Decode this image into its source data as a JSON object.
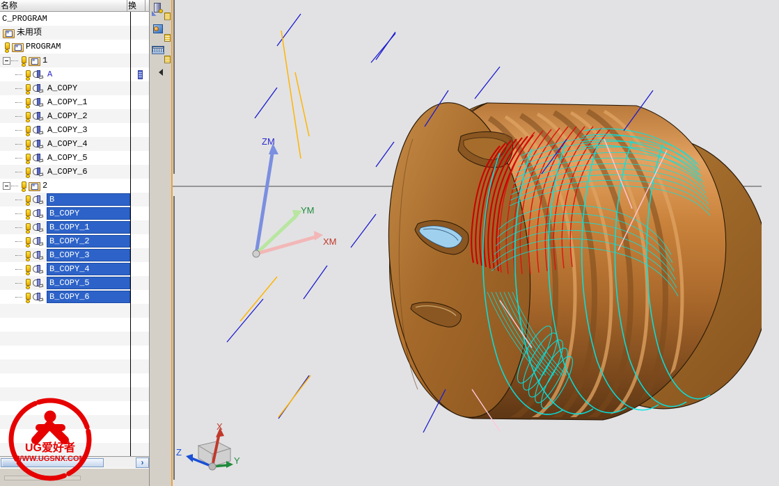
{
  "window": {
    "app": "UG NX Operation Navigator",
    "background_color": "#d4d0c8"
  },
  "navigator": {
    "columns": [
      {
        "key": "name",
        "label": "名称"
      },
      {
        "key": "transform",
        "label": "换"
      }
    ],
    "rows": [
      {
        "indent": 0,
        "text": "C_PROGRAM",
        "type": "root",
        "icon": "none",
        "expander": "none",
        "selected": false,
        "warn": false,
        "extra": ""
      },
      {
        "indent": 1,
        "text": "未用项",
        "type": "group",
        "icon": "folder-icon",
        "expander": "none",
        "selected": false,
        "warn": false,
        "extra": ""
      },
      {
        "indent": 1,
        "text": "PROGRAM",
        "type": "group",
        "icon": "folder-icon",
        "expander": "none",
        "selected": false,
        "warn": true,
        "extra": ""
      },
      {
        "indent": 1,
        "text": "1",
        "type": "group",
        "icon": "folder-icon",
        "expander": "minus",
        "selected": false,
        "warn": true,
        "extra": ""
      },
      {
        "indent": 2,
        "text": "A",
        "type": "op",
        "icon": "operation-icon",
        "expander": "none",
        "selected": false,
        "warn": true,
        "extra": "transform-icon",
        "blue": true
      },
      {
        "indent": 2,
        "text": "A_COPY",
        "type": "op",
        "icon": "operation-icon",
        "expander": "none",
        "selected": false,
        "warn": true,
        "extra": ""
      },
      {
        "indent": 2,
        "text": "A_COPY_1",
        "type": "op",
        "icon": "operation-icon",
        "expander": "none",
        "selected": false,
        "warn": true,
        "extra": ""
      },
      {
        "indent": 2,
        "text": "A_COPY_2",
        "type": "op",
        "icon": "operation-icon",
        "expander": "none",
        "selected": false,
        "warn": true,
        "extra": ""
      },
      {
        "indent": 2,
        "text": "A_COPY_3",
        "type": "op",
        "icon": "operation-icon",
        "expander": "none",
        "selected": false,
        "warn": true,
        "extra": ""
      },
      {
        "indent": 2,
        "text": "A_COPY_4",
        "type": "op",
        "icon": "operation-icon",
        "expander": "none",
        "selected": false,
        "warn": true,
        "extra": ""
      },
      {
        "indent": 2,
        "text": "A_COPY_5",
        "type": "op",
        "icon": "operation-icon",
        "expander": "none",
        "selected": false,
        "warn": true,
        "extra": ""
      },
      {
        "indent": 2,
        "text": "A_COPY_6",
        "type": "op",
        "icon": "operation-icon",
        "expander": "none",
        "selected": false,
        "warn": true,
        "extra": ""
      },
      {
        "indent": 1,
        "text": "2",
        "type": "group",
        "icon": "folder-icon",
        "expander": "minus",
        "selected": false,
        "warn": true,
        "extra": ""
      },
      {
        "indent": 2,
        "text": "B",
        "type": "op",
        "icon": "operation-icon",
        "expander": "none",
        "selected": true,
        "warn": true,
        "extra": ""
      },
      {
        "indent": 2,
        "text": "B_COPY",
        "type": "op",
        "icon": "operation-icon",
        "expander": "none",
        "selected": true,
        "warn": true,
        "extra": ""
      },
      {
        "indent": 2,
        "text": "B_COPY_1",
        "type": "op",
        "icon": "operation-icon",
        "expander": "none",
        "selected": true,
        "warn": true,
        "extra": ""
      },
      {
        "indent": 2,
        "text": "B_COPY_2",
        "type": "op",
        "icon": "operation-icon",
        "expander": "none",
        "selected": true,
        "warn": true,
        "extra": ""
      },
      {
        "indent": 2,
        "text": "B_COPY_3",
        "type": "op",
        "icon": "operation-icon",
        "expander": "none",
        "selected": true,
        "warn": true,
        "extra": ""
      },
      {
        "indent": 2,
        "text": "B_COPY_4",
        "type": "op",
        "icon": "operation-icon",
        "expander": "none",
        "selected": true,
        "warn": true,
        "extra": ""
      },
      {
        "indent": 2,
        "text": "B_COPY_5",
        "type": "op",
        "icon": "operation-icon",
        "expander": "none",
        "selected": true,
        "warn": true,
        "extra": ""
      },
      {
        "indent": 2,
        "text": "B_COPY_6",
        "type": "op",
        "icon": "operation-icon",
        "expander": "none",
        "selected": true,
        "warn": true,
        "extra": ""
      }
    ],
    "empty_row_count": 13,
    "selection_color": "#2d63c8",
    "scrollbar": {
      "right_arrow": "›"
    }
  },
  "toolbar": {
    "buttons": [
      {
        "name": "create-tool-button",
        "tooltip": "创建刀具"
      },
      {
        "name": "create-geometry-button",
        "tooltip": "创建几何体"
      },
      {
        "name": "create-method-button",
        "tooltip": "创建方法"
      }
    ],
    "collapse_label": "◀"
  },
  "graphics": {
    "background_color": "#e2e2e4",
    "model_color": "#b5762f",
    "toolpath_cut_color": "#00e5e5",
    "toolpath_rapid_color": "#1a1ad0",
    "toolpath_engage_color": "#ffc000",
    "toolpath_retract_color": "#ffc8dc",
    "highlight_color": "#cc0000",
    "wcs_labels": {
      "x": "XM",
      "y": "YM",
      "z": "ZM"
    },
    "triad_labels": {
      "x": "X",
      "y": "Y",
      "z": "Z"
    },
    "triad_colors": {
      "x": "#c0392b",
      "y": "#1f8a3c",
      "z": "#1a4fd6"
    }
  },
  "watermark": {
    "brand": "UG爱好者",
    "url": "WWW.UGSNX.COM",
    "color": "#e60000"
  }
}
